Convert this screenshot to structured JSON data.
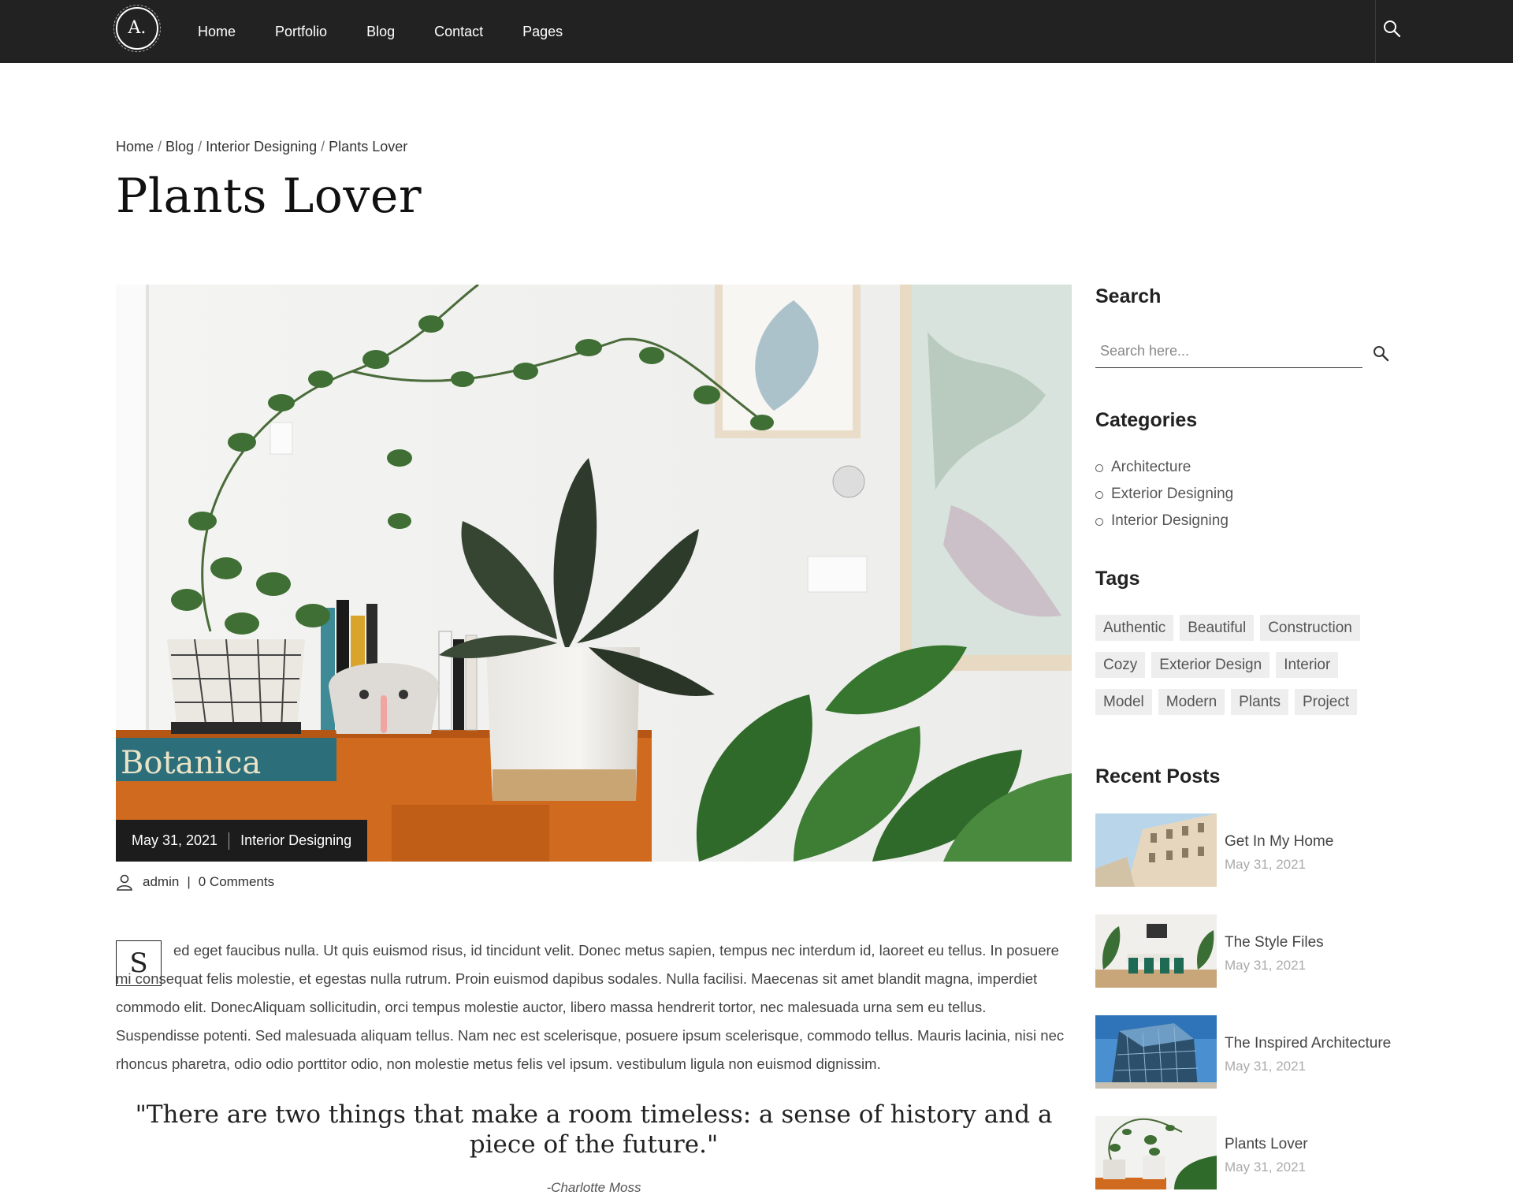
{
  "nav": {
    "logo_text": "A.",
    "items": [
      "Home",
      "Portfolio",
      "Blog",
      "Contact",
      "Pages"
    ]
  },
  "breadcrumb": {
    "items": [
      "Home",
      "Blog",
      "Interior Designing"
    ],
    "current": "Plants Lover",
    "separator": "/"
  },
  "page": {
    "title": "Plants Lover"
  },
  "hero": {
    "book_text": "Botanica",
    "date": "May 31, 2021",
    "category": "Interior Designing"
  },
  "post": {
    "author": "admin",
    "comments": "0 Comments",
    "dropcap": "S",
    "body": "ed eget faucibus nulla. Ut quis euismod risus, id tincidunt velit. Donec metus sapien, tempus nec interdum id, laoreet eu tellus. In posuere mi consequat felis molestie, et egestas nulla rutrum. Proin euismod dapibus sodales. Nulla facilisi. Maecenas sit amet blandit magna, imperdiet commodo elit. DonecAliquam sollicitudin, orci tempus molestie auctor, libero massa hendrerit tortor, nec malesuada urna sem eu tellus. Suspendisse potenti. Sed malesuada aliquam tellus. Nam nec est scelerisque, posuere ipsum scelerisque, commodo tellus. Mauris lacinia, nisi nec rhoncus pharetra, odio odio porttitor odio, non molestie metus felis vel ipsum. vestibulum ligula non euismod dignissim.",
    "quote": "\"There are two things that make a room timeless: a sense of history and a piece of the future.\"",
    "quote_author": "-Charlotte Moss"
  },
  "sidebar": {
    "search_heading": "Search",
    "search_placeholder": "Search here...",
    "categories_heading": "Categories",
    "categories": [
      "Architecture",
      "Exterior Designing",
      "Interior Designing"
    ],
    "tags_heading": "Tags",
    "tags": [
      "Authentic",
      "Beautiful",
      "Construction",
      "Cozy",
      "Exterior Design",
      "Interior",
      "Model",
      "Modern",
      "Plants",
      "Project"
    ],
    "recent_heading": "Recent Posts",
    "recent_posts": [
      {
        "title": "Get In My Home",
        "date": "May 31, 2021"
      },
      {
        "title": "The Style Files",
        "date": "May 31, 2021"
      },
      {
        "title": "The Inspired Architecture",
        "date": "May 31, 2021"
      },
      {
        "title": "Plants Lover",
        "date": "May 31, 2021"
      }
    ]
  },
  "colors": {
    "nav_bg": "#222222",
    "tag_bg": "#eeeeee",
    "badge_bg": "#1c1c1c"
  },
  "icons": [
    "search-icon",
    "user-icon",
    "circle-bullet-icon"
  ]
}
